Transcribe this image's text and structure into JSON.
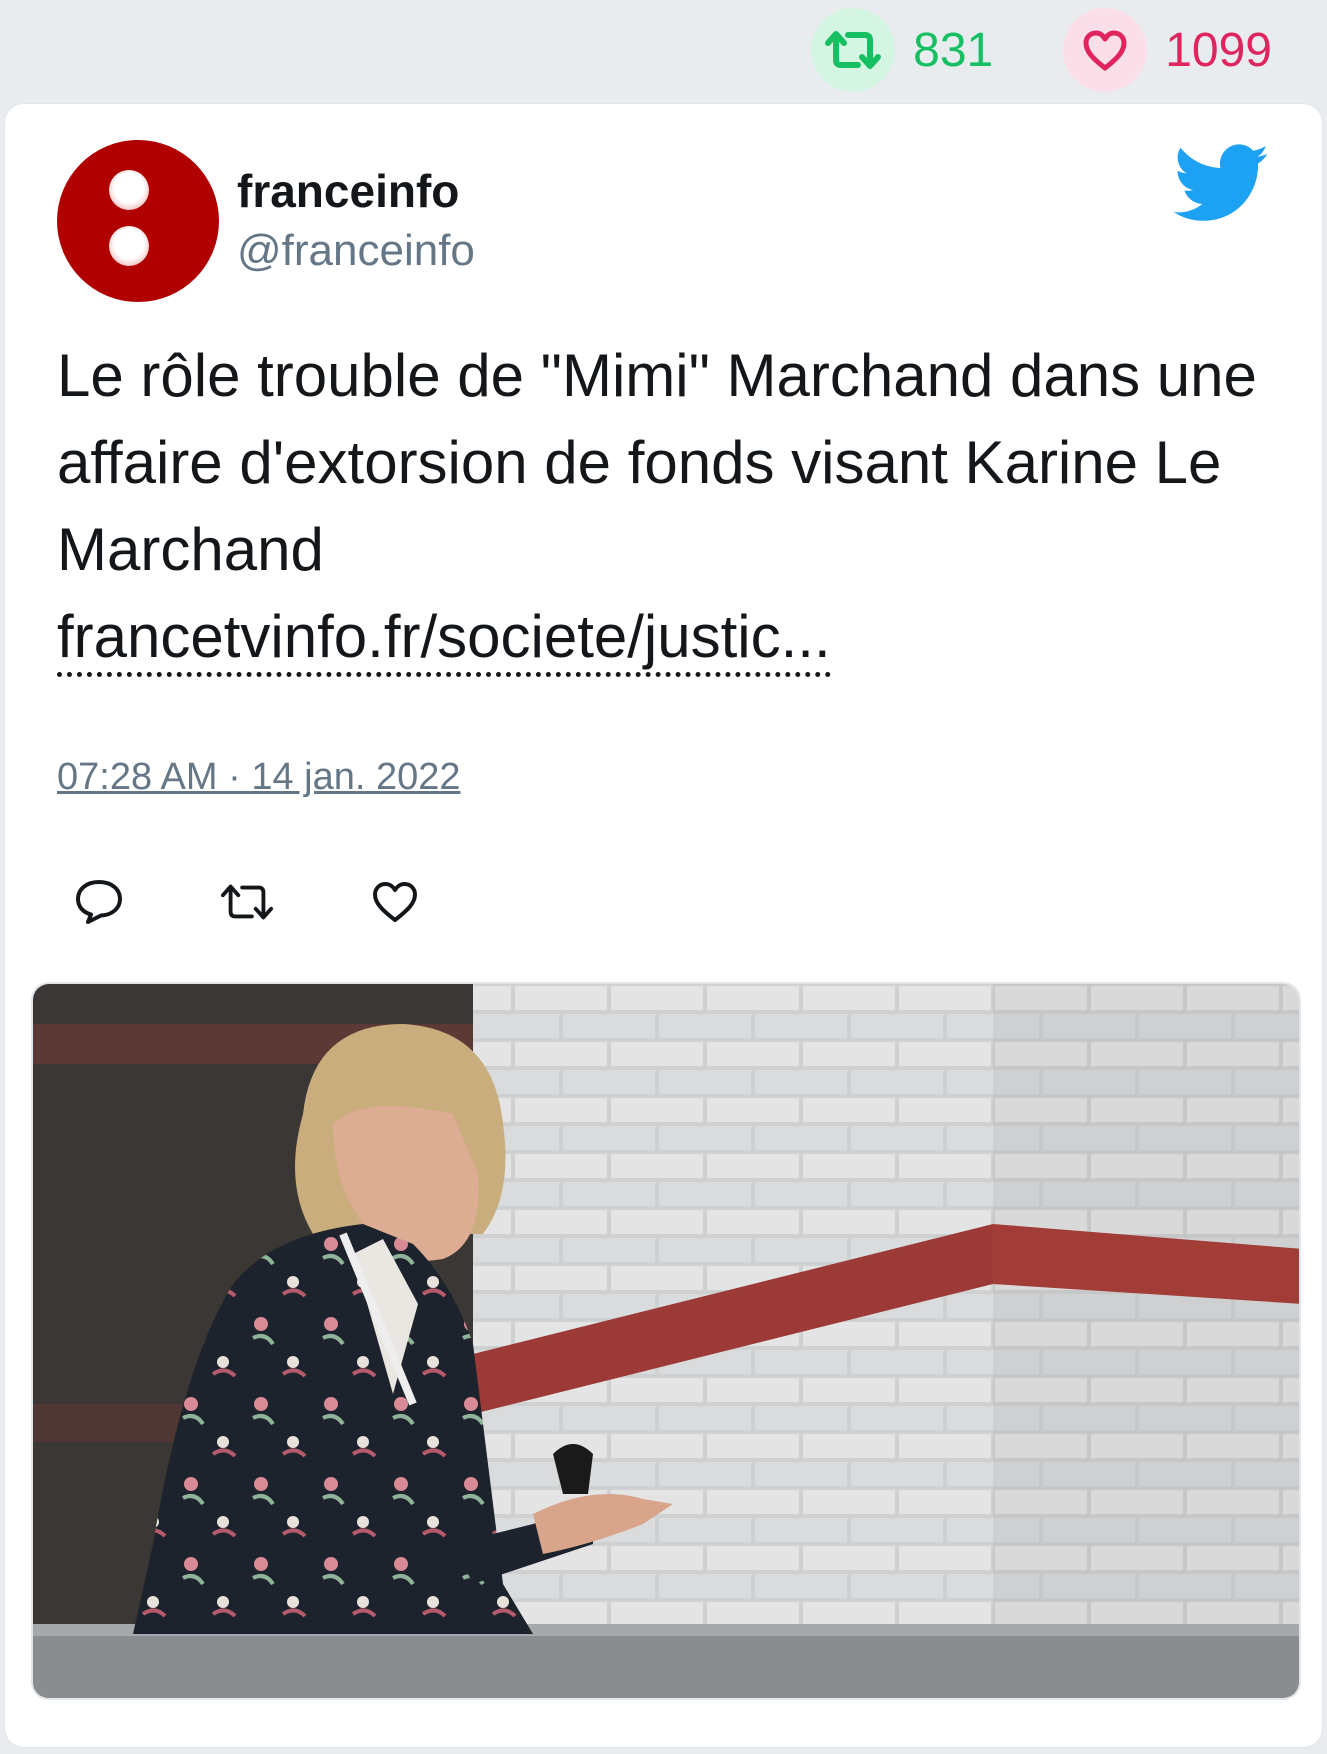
{
  "stats": {
    "retweets": "831",
    "likes": "1099"
  },
  "tweet": {
    "author_name": "franceinfo",
    "author_handle": "@franceinfo",
    "text": "Le rôle trouble de \"Mimi\" Marchand dans une affaire d'extorsion de fonds visant Karine Le Marchand",
    "link": "francetvinfo.fr/societe/justic...",
    "timestamp": "07:28 AM · 14 jan. 2022"
  },
  "icons": {
    "retweet_stat": "retweet-icon",
    "like_stat": "heart-icon",
    "brand": "twitter-bird-icon",
    "reply_action": "reply-icon",
    "retweet_action": "retweet-icon",
    "like_action": "heart-icon"
  },
  "colors": {
    "retweet": "#17bf63",
    "like": "#e0245e",
    "twitter_blue": "#1da1f2",
    "avatar": "#b10000",
    "muted": "#657786"
  }
}
